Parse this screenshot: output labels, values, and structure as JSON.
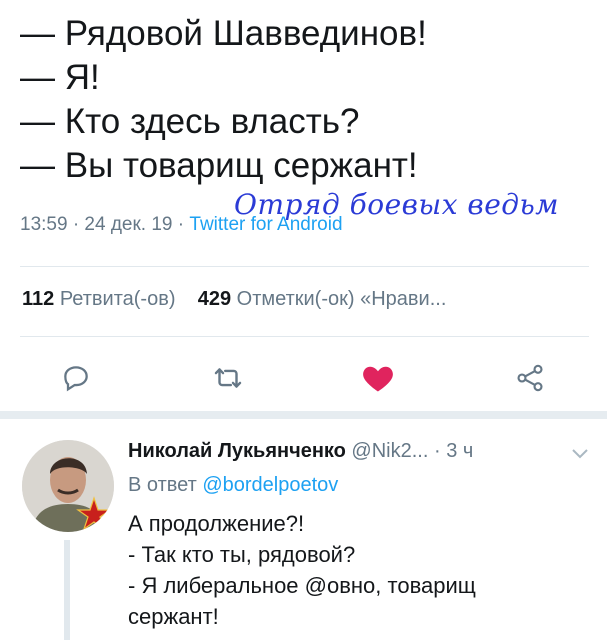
{
  "tweet": {
    "lines": [
      "— Рядовой Шавведин<br>ов!",
      "— Я!",
      "— Кто здесь власть?",
      "— Вы товарищ сержант!"
    ],
    "time": "13:59 · 24 дек. 19 · ",
    "source": "Twitter for Android",
    "watermark": "Отряд боевых ведьм"
  },
  "stats": {
    "retweets_count": "112",
    "retweets_label": "Ретвита(-ов)",
    "likes_count": "429",
    "likes_label": "Отметки(-ок) «Нрави..."
  },
  "colors": {
    "like": "#e0245e",
    "link": "#1da1f2",
    "muted": "#657786"
  },
  "reply": {
    "name": "Николай Лукьянченко",
    "handle": " @Nik2... · 3 ч",
    "reply_prefix": "В ответ ",
    "reply_mention": "@bordelpoetov",
    "lines": [
      "А продолжение?!",
      "- Так кто ты, рядовой?",
      "- Я либеральное @овно, товарищ",
      "сержант!"
    ]
  }
}
